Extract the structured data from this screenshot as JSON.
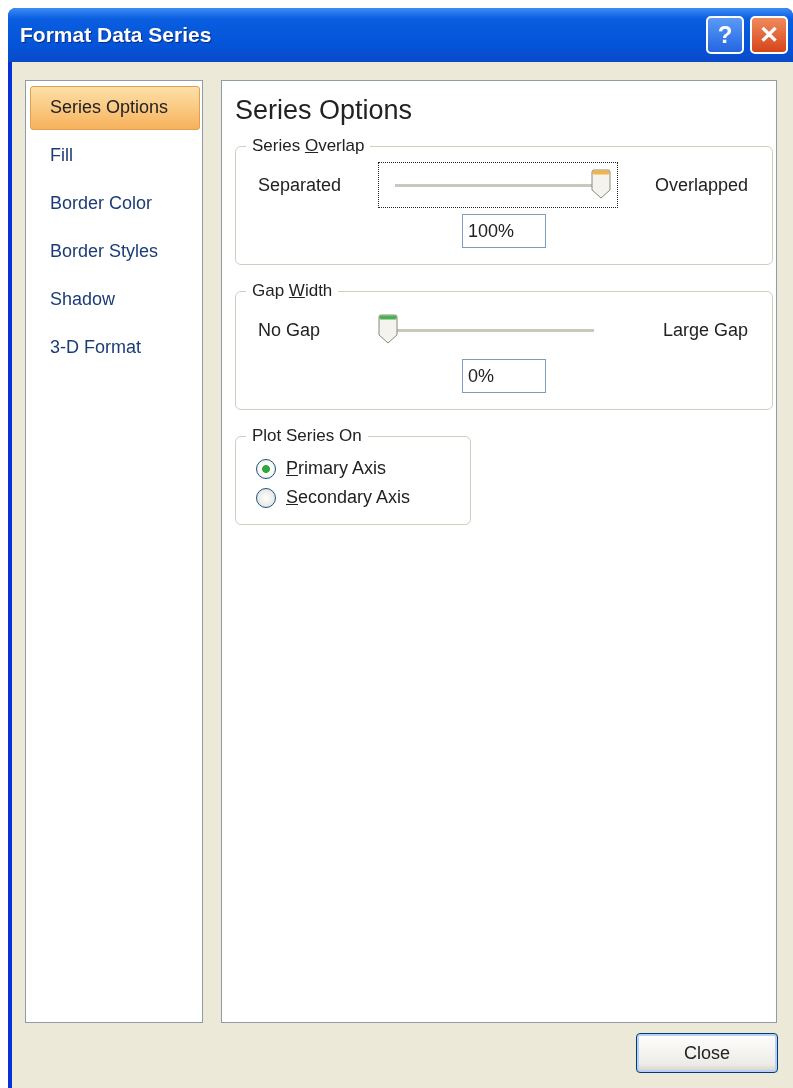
{
  "window": {
    "title": "Format Data Series"
  },
  "title_buttons": [
    {
      "kind": "help",
      "label": "?"
    },
    {
      "kind": "close",
      "label": "✕"
    }
  ],
  "sidebar": {
    "items": [
      {
        "label": "Series Options",
        "selected": true
      },
      {
        "label": "Fill",
        "selected": false
      },
      {
        "label": "Border Color",
        "selected": false
      },
      {
        "label": "Border Styles",
        "selected": false
      },
      {
        "label": "Shadow",
        "selected": false
      },
      {
        "label": "3-D Format",
        "selected": false
      }
    ]
  },
  "panel": {
    "heading": "Series Options",
    "groups": [
      {
        "kind": "slider",
        "legend_parts": [
          {
            "text": "Series ",
            "underline": false
          },
          {
            "text": "O",
            "underline": true
          },
          {
            "text": "verlap",
            "underline": false
          }
        ],
        "left_label": "Separated",
        "right_label": "Overlapped",
        "level": 1,
        "focused": true,
        "value": "100%"
      },
      {
        "kind": "slider",
        "legend_parts": [
          {
            "text": "Gap ",
            "underline": false
          },
          {
            "text": "W",
            "underline": true
          },
          {
            "text": "idth",
            "underline": false
          }
        ],
        "left_label": "No Gap",
        "right_label": "Large Gap",
        "level": 0,
        "focused": false,
        "value": "0%"
      },
      {
        "kind": "radios",
        "legend_parts": [
          {
            "text": "Plot Series On",
            "underline": false
          }
        ],
        "options": [
          {
            "label_parts": [
              {
                "text": "P",
                "underline": true
              },
              {
                "text": "rimary Axis",
                "underline": false
              }
            ],
            "selected": true
          },
          {
            "label_parts": [
              {
                "text": "S",
                "underline": true
              },
              {
                "text": "econdary Axis",
                "underline": false
              }
            ],
            "selected": false
          }
        ]
      }
    ]
  },
  "buttons": [
    {
      "label": "Close"
    }
  ]
}
